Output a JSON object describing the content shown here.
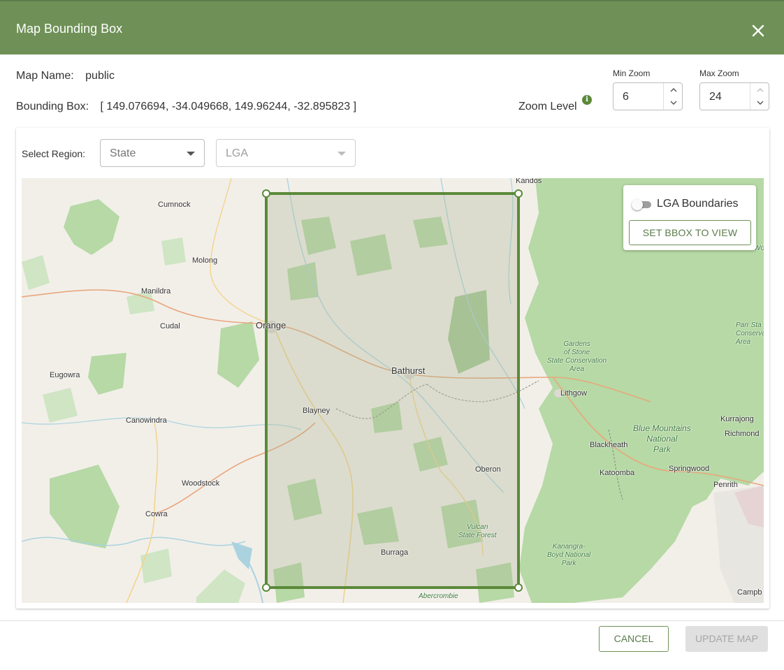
{
  "dialog": {
    "title": "Map Bounding Box",
    "close_icon": "close-icon"
  },
  "info": {
    "map_name_label": "Map Name:",
    "map_name_value": "public",
    "bbox_label": "Bounding Box:",
    "bbox_value": "[ 149.076694, -34.049668, 149.96244, -32.895823 ]",
    "zoom_level_label": "Zoom Level",
    "zoom_info_icon": "info-icon"
  },
  "zoom": {
    "min_label": "Min Zoom",
    "min_value": "6",
    "max_label": "Max Zoom",
    "max_value": "24"
  },
  "region": {
    "label": "Select Region:",
    "state_placeholder": "State",
    "lga_placeholder": "LGA"
  },
  "map": {
    "control": {
      "toggle_label": "LGA Boundaries",
      "toggle_on": false,
      "set_bbox_button": "SET BBOX TO VIEW"
    },
    "places": {
      "kandos": "Kandos",
      "cumnock": "Cumnock",
      "molong": "Molong",
      "manildra": "Manildra",
      "cudal": "Cudal",
      "orange": "Orange",
      "eugowra": "Eugowra",
      "bathurst": "Bathurst",
      "blayney": "Blayney",
      "canowindra": "Canowindra",
      "lithgow": "Lithgow",
      "oberon": "Oberon",
      "woodstock": "Woodstock",
      "cowra": "Cowra",
      "burraga": "Burraga",
      "blackheath": "Blackheath",
      "katoomba": "Katoomba",
      "springwood": "Springwood",
      "kurrajong": "Kurrajong",
      "richmond": "Richmond",
      "penrith": "Penrith",
      "campb": "Campb",
      "gardens_of_stone": "Gardens\nof Stone\nState Conservation\nArea",
      "blue_mountains": "Blue Mountains\nNational\nPark",
      "vulcan": "Vulcan\nState Forest",
      "kanangra": "Kanangra-\nBoyd National\nPark",
      "abercrombie": "Abercrombie",
      "parr": "Parr Sta\nConserva\nArea",
      "wollemi_partial": "Wollo"
    },
    "colors": {
      "land": "#f2efe9",
      "forest": "#add19e",
      "water": "#aad3df",
      "bbox": "#5b8a3a"
    }
  },
  "footer": {
    "cancel": "CANCEL",
    "update": "UPDATE MAP"
  }
}
